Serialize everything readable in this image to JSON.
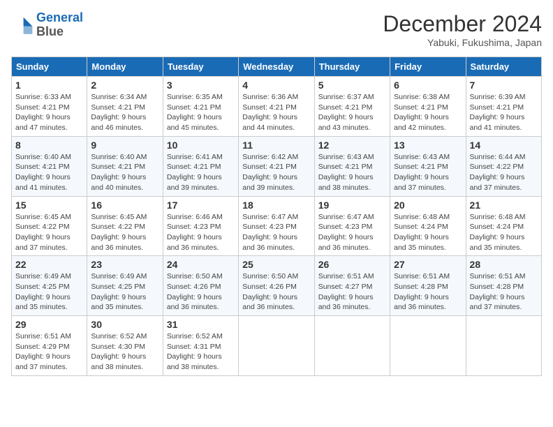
{
  "header": {
    "logo_line1": "General",
    "logo_line2": "Blue",
    "month": "December 2024",
    "location": "Yabuki, Fukushima, Japan"
  },
  "weekdays": [
    "Sunday",
    "Monday",
    "Tuesday",
    "Wednesday",
    "Thursday",
    "Friday",
    "Saturday"
  ],
  "weeks": [
    [
      {
        "day": "1",
        "sunrise": "6:33 AM",
        "sunset": "4:21 PM",
        "daylight": "9 hours and 47 minutes."
      },
      {
        "day": "2",
        "sunrise": "6:34 AM",
        "sunset": "4:21 PM",
        "daylight": "9 hours and 46 minutes."
      },
      {
        "day": "3",
        "sunrise": "6:35 AM",
        "sunset": "4:21 PM",
        "daylight": "9 hours and 45 minutes."
      },
      {
        "day": "4",
        "sunrise": "6:36 AM",
        "sunset": "4:21 PM",
        "daylight": "9 hours and 44 minutes."
      },
      {
        "day": "5",
        "sunrise": "6:37 AM",
        "sunset": "4:21 PM",
        "daylight": "9 hours and 43 minutes."
      },
      {
        "day": "6",
        "sunrise": "6:38 AM",
        "sunset": "4:21 PM",
        "daylight": "9 hours and 42 minutes."
      },
      {
        "day": "7",
        "sunrise": "6:39 AM",
        "sunset": "4:21 PM",
        "daylight": "9 hours and 41 minutes."
      }
    ],
    [
      {
        "day": "8",
        "sunrise": "6:40 AM",
        "sunset": "4:21 PM",
        "daylight": "9 hours and 41 minutes."
      },
      {
        "day": "9",
        "sunrise": "6:40 AM",
        "sunset": "4:21 PM",
        "daylight": "9 hours and 40 minutes."
      },
      {
        "day": "10",
        "sunrise": "6:41 AM",
        "sunset": "4:21 PM",
        "daylight": "9 hours and 39 minutes."
      },
      {
        "day": "11",
        "sunrise": "6:42 AM",
        "sunset": "4:21 PM",
        "daylight": "9 hours and 39 minutes."
      },
      {
        "day": "12",
        "sunrise": "6:43 AM",
        "sunset": "4:21 PM",
        "daylight": "9 hours and 38 minutes."
      },
      {
        "day": "13",
        "sunrise": "6:43 AM",
        "sunset": "4:21 PM",
        "daylight": "9 hours and 37 minutes."
      },
      {
        "day": "14",
        "sunrise": "6:44 AM",
        "sunset": "4:22 PM",
        "daylight": "9 hours and 37 minutes."
      }
    ],
    [
      {
        "day": "15",
        "sunrise": "6:45 AM",
        "sunset": "4:22 PM",
        "daylight": "9 hours and 37 minutes."
      },
      {
        "day": "16",
        "sunrise": "6:45 AM",
        "sunset": "4:22 PM",
        "daylight": "9 hours and 36 minutes."
      },
      {
        "day": "17",
        "sunrise": "6:46 AM",
        "sunset": "4:23 PM",
        "daylight": "9 hours and 36 minutes."
      },
      {
        "day": "18",
        "sunrise": "6:47 AM",
        "sunset": "4:23 PM",
        "daylight": "9 hours and 36 minutes."
      },
      {
        "day": "19",
        "sunrise": "6:47 AM",
        "sunset": "4:23 PM",
        "daylight": "9 hours and 36 minutes."
      },
      {
        "day": "20",
        "sunrise": "6:48 AM",
        "sunset": "4:24 PM",
        "daylight": "9 hours and 35 minutes."
      },
      {
        "day": "21",
        "sunrise": "6:48 AM",
        "sunset": "4:24 PM",
        "daylight": "9 hours and 35 minutes."
      }
    ],
    [
      {
        "day": "22",
        "sunrise": "6:49 AM",
        "sunset": "4:25 PM",
        "daylight": "9 hours and 35 minutes."
      },
      {
        "day": "23",
        "sunrise": "6:49 AM",
        "sunset": "4:25 PM",
        "daylight": "9 hours and 35 minutes."
      },
      {
        "day": "24",
        "sunrise": "6:50 AM",
        "sunset": "4:26 PM",
        "daylight": "9 hours and 36 minutes."
      },
      {
        "day": "25",
        "sunrise": "6:50 AM",
        "sunset": "4:26 PM",
        "daylight": "9 hours and 36 minutes."
      },
      {
        "day": "26",
        "sunrise": "6:51 AM",
        "sunset": "4:27 PM",
        "daylight": "9 hours and 36 minutes."
      },
      {
        "day": "27",
        "sunrise": "6:51 AM",
        "sunset": "4:28 PM",
        "daylight": "9 hours and 36 minutes."
      },
      {
        "day": "28",
        "sunrise": "6:51 AM",
        "sunset": "4:28 PM",
        "daylight": "9 hours and 37 minutes."
      }
    ],
    [
      {
        "day": "29",
        "sunrise": "6:51 AM",
        "sunset": "4:29 PM",
        "daylight": "9 hours and 37 minutes."
      },
      {
        "day": "30",
        "sunrise": "6:52 AM",
        "sunset": "4:30 PM",
        "daylight": "9 hours and 38 minutes."
      },
      {
        "day": "31",
        "sunrise": "6:52 AM",
        "sunset": "4:31 PM",
        "daylight": "9 hours and 38 minutes."
      },
      null,
      null,
      null,
      null
    ]
  ]
}
